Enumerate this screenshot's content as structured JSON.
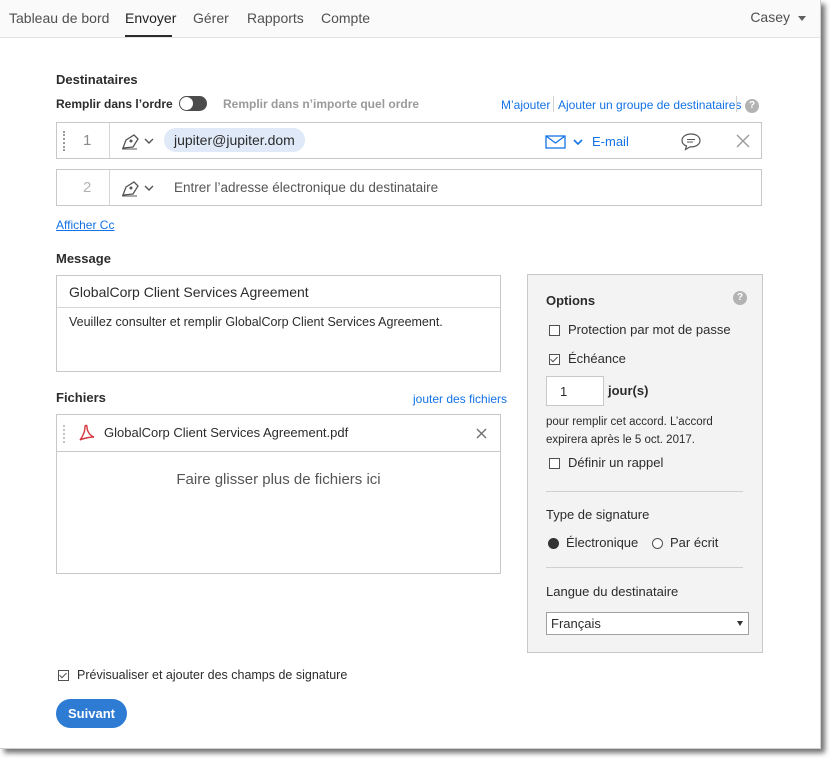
{
  "nav": {
    "tabs": [
      "Tableau de bord",
      "Envoyer",
      "Gérer",
      "Rapports",
      "Compte"
    ],
    "user": "Casey"
  },
  "recipients": {
    "heading": "Destinataires",
    "order_label": "Remplir dans l’ordre",
    "any_order_label": "Remplir dans n’importe quel ordre",
    "add_me": "M’ajouter",
    "add_group": "Ajouter un groupe de destinataires",
    "rows": [
      {
        "number": "1",
        "email": "jupiter@jupiter.dom",
        "method": "E-mail"
      },
      {
        "number": "2",
        "placeholder": "Entrer l’adresse électronique du destinataire"
      }
    ],
    "show_cc": "Afficher Cc"
  },
  "message": {
    "heading": "Message",
    "title": "GlobalCorp Client Services Agreement",
    "body": "Veuillez consulter et remplir GlobalCorp Client Services Agreement."
  },
  "files": {
    "heading": "Fichiers",
    "add_files": "jouter des fichiers",
    "file_name": "GlobalCorp Client Services Agreement.pdf",
    "drop_text": "Faire glisser plus de fichiers ici"
  },
  "options": {
    "heading": "Options",
    "password_label": "Protection par mot de passe",
    "password_checked": false,
    "deadline_label": "Échéance",
    "deadline_checked": true,
    "days_value": "1",
    "days_unit": "jour(s)",
    "deadline_note_1": "pour remplir cet accord. L’accord",
    "deadline_note_2": "expirera après le 5 oct. 2017.",
    "reminder_label": "Définir un rappel",
    "reminder_checked": false,
    "signature_type_heading": "Type de signature",
    "sig_electronic": "Électronique",
    "sig_written": "Par écrit",
    "sig_selected": "Électronique",
    "language_heading": "Langue du destinataire",
    "language_value": "Français"
  },
  "footer": {
    "preview_label": "Prévisualiser et ajouter des champs de signature",
    "preview_checked": true,
    "next_button": "Suivant"
  },
  "colors": {
    "accent": "#1473e6",
    "button": "#2d7bd3"
  }
}
